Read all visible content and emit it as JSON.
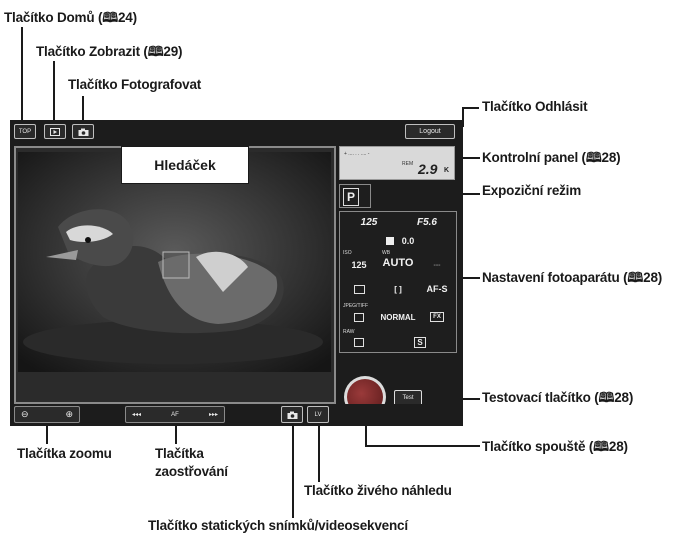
{
  "callouts": {
    "home": "Tlačítko Domů (🕮24)",
    "view": "Tlačítko Zobrazit (🕮29)",
    "shoot": "Tlačítko Fotografovat",
    "logout": "Tlačítko Odhlásit",
    "control_panel": "Kontrolní panel (🕮28)",
    "exposure_mode": "Expoziční režim",
    "camera_settings": "Nastavení fotoaparátu (🕮28)",
    "test_button": "Testovací tlačítko (🕮28)",
    "shutter": "Tlačítko spouště (🕮28)",
    "live_view": "Tlačítko živého náhledu",
    "still_video": "Tlačítko statických snímků/videosekvencí",
    "zoom_line1": "Tlačítka zoomu",
    "focus_line1": "Tlačítka",
    "focus_line2": "zaostřování"
  },
  "ui": {
    "top_label": "TOP",
    "logout_label": "Logout",
    "viewfinder_label": "Hledáček",
    "shutter_speed": "125",
    "aperture": "F5.6",
    "exposure_comp": "0.0",
    "iso_label": "ISO",
    "iso_value": "125",
    "wb_label": "WB",
    "wb_value": "AUTO",
    "wb_extra": "---",
    "focus_mode": "AF-S",
    "jpeg_label": "JPEG/TIFF",
    "quality": "NORMAL",
    "fx_label": "FX",
    "raw_label": "RAW",
    "size_label": "S",
    "rem_label": "REM",
    "rem_value": "2.9",
    "rem_unit": "K",
    "af_label": "AF",
    "lv_label": "LV",
    "test_label": "Test",
    "mode_letter": "P"
  },
  "colors": {
    "accent_panel": "#1c1c1c",
    "frame": "#8a8a8a"
  }
}
